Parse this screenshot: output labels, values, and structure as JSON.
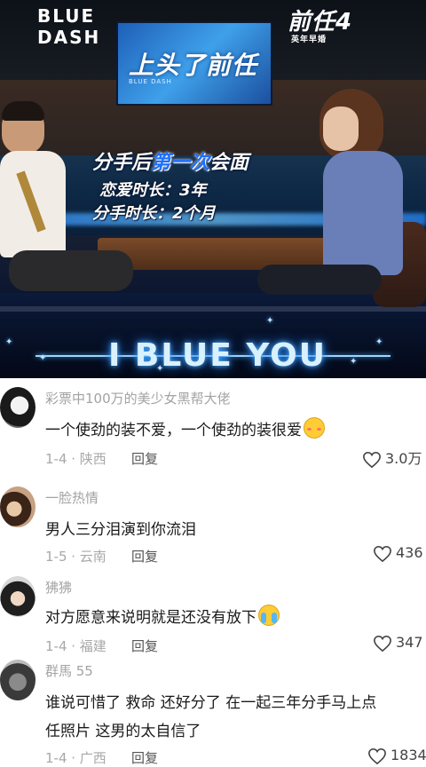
{
  "video": {
    "brand_line1": "BLUE",
    "brand_line2": "DASH",
    "show_logo": "前任4",
    "show_logo_sub": "英年早婚",
    "tv_title": "上头了前任",
    "tv_sub": "BLUE DASH",
    "caption_prefix": "分手后",
    "caption_highlight": "第一次",
    "caption_suffix": "会面",
    "caption_love": "恋爱时长：3年",
    "caption_breakup": "分手时长：2个月",
    "neon_sign": "I BLUE YOU"
  },
  "comments": [
    {
      "username": "彩票中100万的美少女黑帮大佬",
      "text": "一个使劲的装不爱，一个使劲的装很爱",
      "emoji": "flushed-emoji",
      "meta": "1-4 · 陕西",
      "reply_label": "回复",
      "likes": "3.0万"
    },
    {
      "username": "一脸热情",
      "text": "男人三分泪演到你流泪",
      "emoji": "",
      "meta": "1-5 · 云南",
      "reply_label": "回复",
      "likes": "436"
    },
    {
      "username": "狒狒",
      "text": "对方愿意来说明就是还没有放下",
      "emoji": "crying-emoji",
      "meta": "1-4 · 福建",
      "reply_label": "回复",
      "likes": "347"
    },
    {
      "username": "群馬 55",
      "text": "谁说可惜了 救命 还好分了 在一起三年分手马上点",
      "text2": "任照片 这男的太自信了",
      "emoji": "",
      "meta": "1-4 · 广西",
      "reply_label": "回复",
      "likes": "1834"
    }
  ]
}
